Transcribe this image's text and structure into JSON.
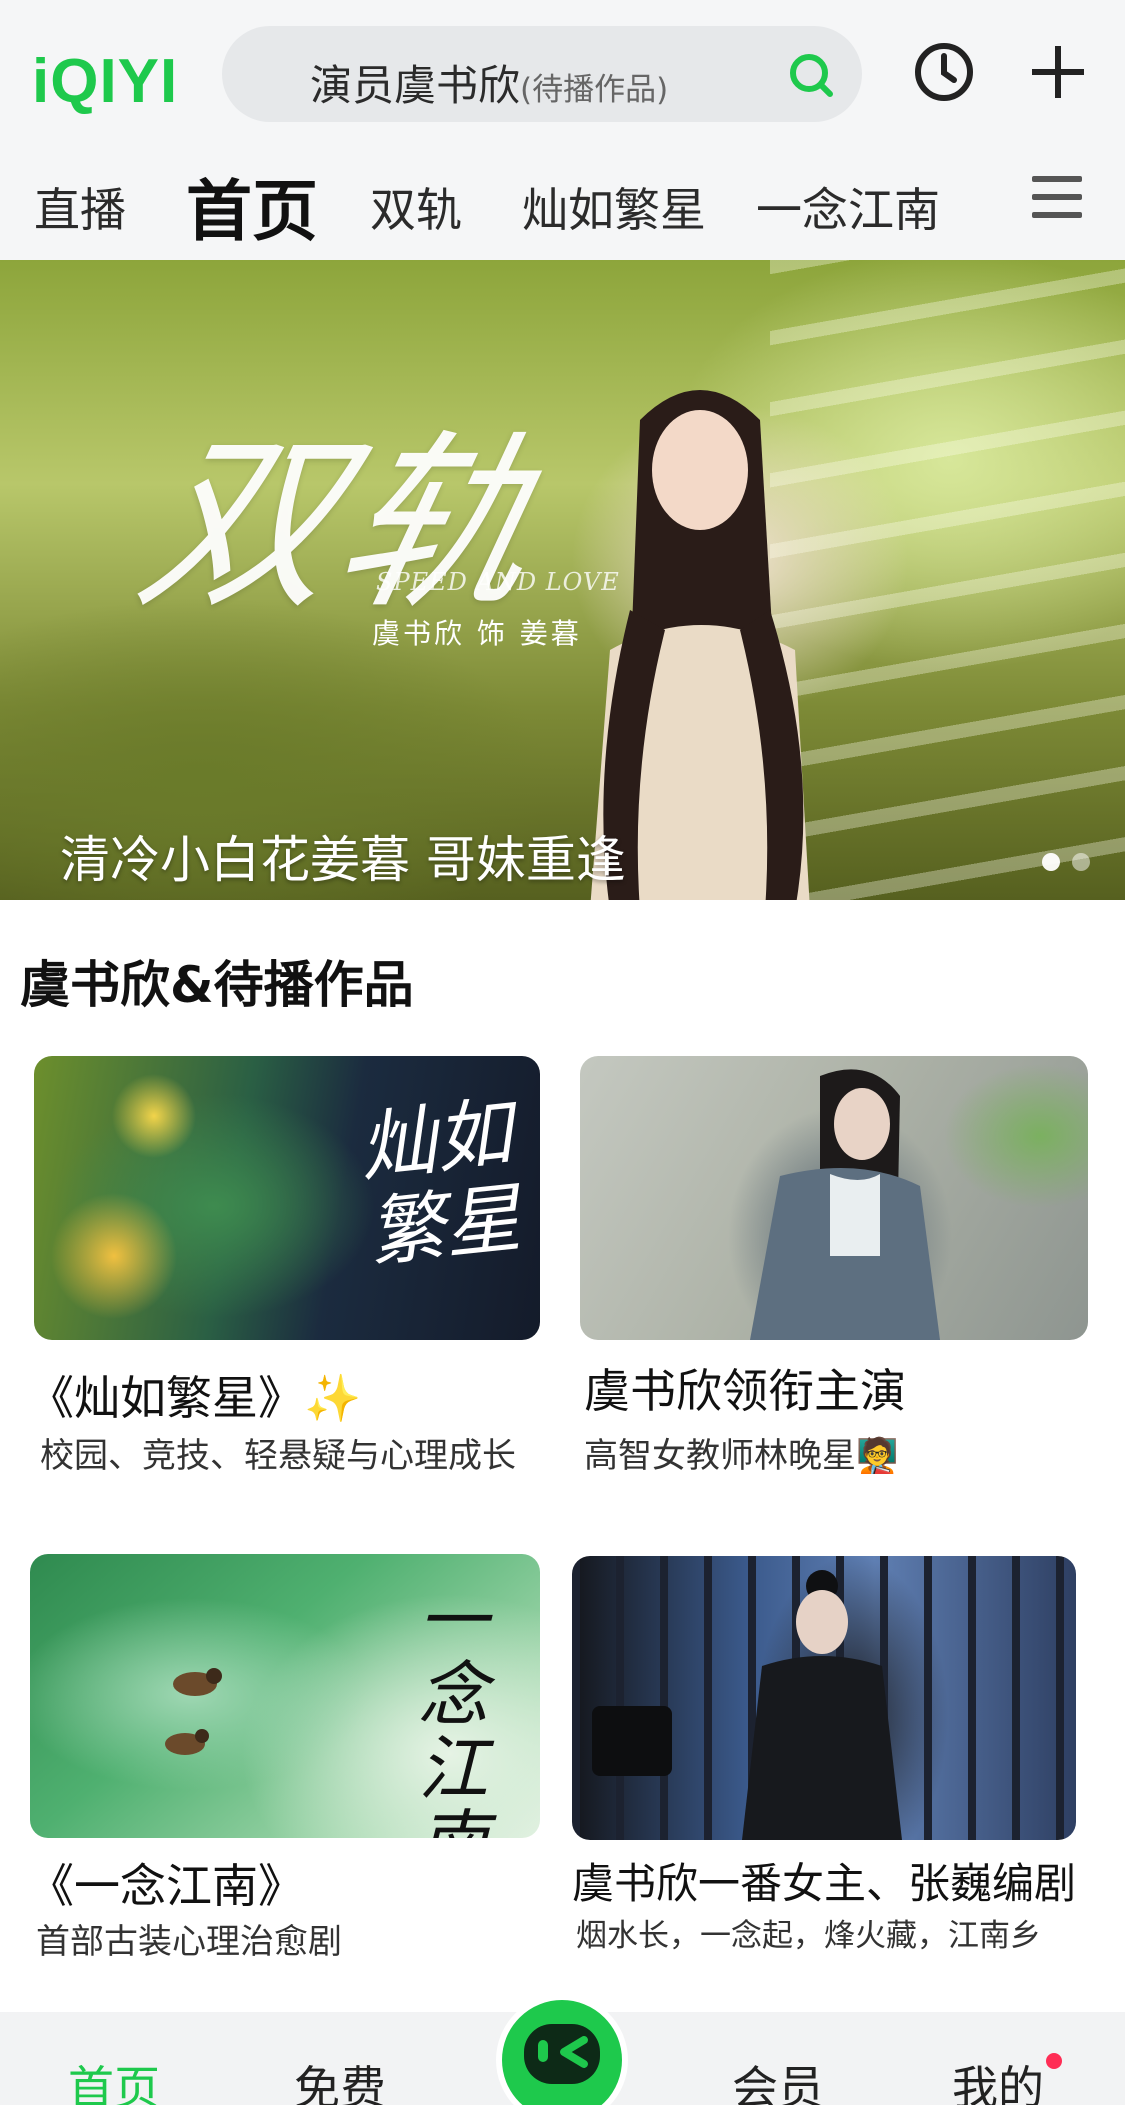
{
  "header": {
    "logo_text": "iQIYI",
    "search_query": "演员虞书欣",
    "search_hint": "(待播作品)"
  },
  "nav": {
    "tabs": [
      {
        "label": "直播"
      },
      {
        "label": "首页",
        "active": true
      },
      {
        "label": "双轨"
      },
      {
        "label": "灿如繁星"
      },
      {
        "label": "一念江南"
      }
    ]
  },
  "banner": {
    "show_title": "双轨",
    "english_title": "SPEED AND LOVE",
    "role_text": "虞书欣 饰 姜暮",
    "caption": "清冷小白花姜暮 哥妹重逢",
    "dots_count": 2,
    "active_dot": 0
  },
  "section": {
    "title": "虞书欣&待播作品",
    "cards": [
      {
        "title": "《灿如繁星》✨",
        "subtitle": "校园、竞技、轻悬疑与心理成长",
        "poster_text": "灿如繁星"
      },
      {
        "title": "虞书欣领衔主演",
        "subtitle": "高智女教师林晚星🧑‍🏫"
      },
      {
        "title": "《一念江南》",
        "subtitle": "首部古装心理治愈剧",
        "poster_text": "一念江南"
      },
      {
        "title": "虞书欣一番女主、张巍编剧",
        "subtitle": "烟水长，一念起，烽火藏，江南乡"
      }
    ]
  },
  "bottom_nav": {
    "items": [
      {
        "label": "首页",
        "active": true
      },
      {
        "label": "免费"
      },
      {
        "label": "会员"
      },
      {
        "label": "我的",
        "badge": true
      }
    ]
  },
  "colors": {
    "brand_green": "#1ec94c",
    "badge_red": "#ff2d55"
  }
}
